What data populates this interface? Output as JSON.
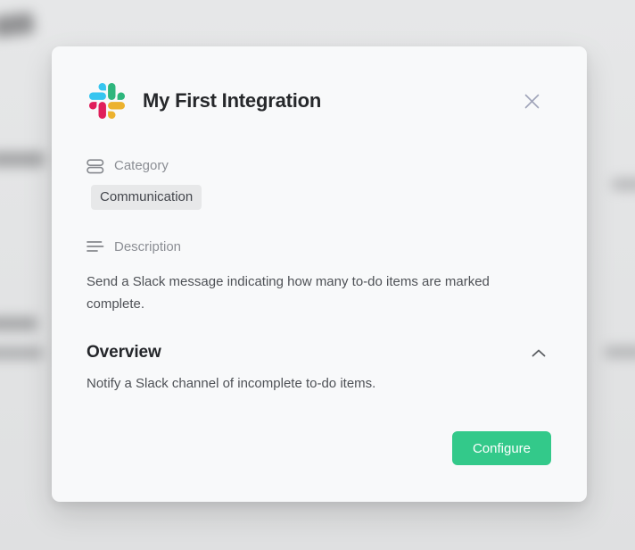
{
  "modal": {
    "title": "My First Integration",
    "app_icon": "slack-logo",
    "close_icon": "close-x",
    "category": {
      "label": "Category",
      "value": "Communication"
    },
    "description": {
      "label": "Description",
      "text": "Send a Slack message indicating how many to-do items are marked complete."
    },
    "overview": {
      "heading": "Overview",
      "text": "Notify a Slack channel of incomplete to-do items.",
      "state": "expanded"
    },
    "footer": {
      "configure_label": "Configure"
    },
    "colors": {
      "accent_button": "#33c98a",
      "modal_background": "#f8f9fa",
      "backdrop": "#e3e4e5",
      "badge_background": "#e7e8e9",
      "slack_blue": "#36C5F0",
      "slack_green": "#2EB67D",
      "slack_red": "#E01E5A",
      "slack_yellow": "#ECB22E"
    }
  }
}
